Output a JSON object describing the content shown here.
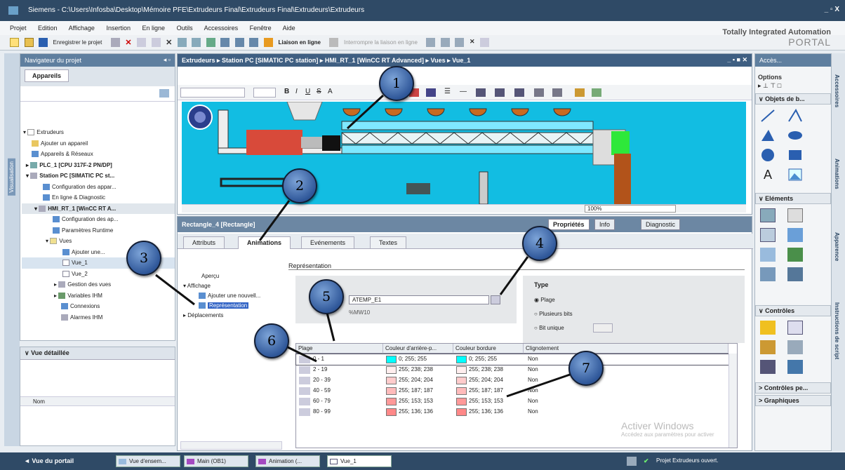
{
  "window": {
    "title": "Siemens  -  C:\\Users\\Infosba\\Desktop\\Mémoire PFE\\Extrudeurs Final\\Extrudeurs Final\\Extrudeurs\\Extrudeurs",
    "controls": "_ ▫ X"
  },
  "menu": [
    "Projet",
    "Edition",
    "Affichage",
    "Insertion",
    "En ligne",
    "Outils",
    "Accessoires",
    "Fenêtre",
    "Aide"
  ],
  "toolbar": {
    "save": "Enregistrer le projet",
    "online": "Liaison en ligne",
    "offline": "Interrompre la liaison en ligne"
  },
  "brand": {
    "line1": "Totally Integrated Automation",
    "line2": "PORTAL"
  },
  "sidebar_tab": "Visualisation",
  "project_nav": {
    "header": "Navigateur du projet",
    "tab": "Appareils",
    "items": [
      "Extrudeurs",
      "Ajouter un appareil",
      "Appareils & Réseaux",
      "PLC_1 [CPU 317F-2 PN/DP]",
      "Station PC [SIMATIC PC st...",
      "Configuration des appar...",
      "En ligne & Diagnostic",
      "HMI_RT_1 [WinCC RT A...",
      "Configuration des ap...",
      "Paramètres Runtime",
      "Vues",
      "Ajouter une...",
      "Vue_1",
      "Vue_2",
      "Gestion des vues",
      "Variables IHM",
      "Connexions",
      "Alarmes IHM"
    ]
  },
  "detail_view": {
    "header": "Vue détaillée",
    "col": "Nom"
  },
  "editor": {
    "breadcrumb": "Extrudeurs  ▸  Station PC [SIMATIC PC station]  ▸  HMI_RT_1 [WinCC RT Advanced]  ▸  Vues  ▸  Vue_1",
    "zoom": "100%"
  },
  "properties": {
    "title": "Rectangle_4 [Rectangle]",
    "tabs_right": [
      "Propriétés",
      "Info",
      "Diagnostic"
    ],
    "tabs": [
      "Attributs",
      "Animations",
      "Evénements",
      "Textes"
    ],
    "tree": [
      "Aperçu",
      "Affichage",
      "Ajouter une nouvell...",
      "Représentation",
      "Déplacements"
    ],
    "section": "Représentation",
    "tag": "ATEMP_E1",
    "address": "%MW10",
    "type_label": "Type",
    "types": [
      "Plage",
      "Plusieurs bits",
      "Bit unique"
    ],
    "columns": [
      "Plage",
      "Couleur d'arrière-p...",
      "Couleur bordure",
      "Clignotement"
    ],
    "rows": [
      {
        "range": "0 - 1",
        "bg": "0; 255; 255",
        "border": "0; 255; 255",
        "blink": "Non",
        "color": "#00ffff"
      },
      {
        "range": "2 - 19",
        "bg": "255; 238; 238",
        "border": "255; 238; 238",
        "blink": "Non",
        "color": "#ffeeee"
      },
      {
        "range": "20 - 39",
        "bg": "255; 204; 204",
        "border": "255; 204; 204",
        "blink": "Non",
        "color": "#ffcccc"
      },
      {
        "range": "40 - 59",
        "bg": "255; 187; 187",
        "border": "255; 187; 187",
        "blink": "Non",
        "color": "#ffbbbb"
      },
      {
        "range": "60 - 79",
        "bg": "255; 153; 153",
        "border": "255; 153; 153",
        "blink": "Non",
        "color": "#ff9999"
      },
      {
        "range": "80 - 99",
        "bg": "255; 136; 136",
        "border": "255; 136; 136",
        "blink": "Non",
        "color": "#ff8888"
      }
    ]
  },
  "watermark": {
    "l1": "Activer Windows",
    "l2": "Accédez aux paramètres pour activer"
  },
  "tasks": {
    "header": "Accès...",
    "options": "Options",
    "sections": [
      "Objets de b...",
      "Eléments",
      "Contrôles",
      "Contrôles pe...",
      "Graphiques"
    ],
    "strip": [
      "Accessoires",
      "Animations",
      "Apparence",
      "Instructions de script"
    ]
  },
  "status": {
    "portal": "◄  Vue du portail",
    "tasks": [
      "Vue d'ensem...",
      "Main (OB1)",
      "Animation (...",
      "Vue_1"
    ],
    "right": "Projet Extrudeurs ouvert."
  },
  "callouts": [
    "1",
    "2",
    "3",
    "4",
    "5",
    "6",
    "7"
  ],
  "colors": {
    "canvas": "#12bde2",
    "title": "#2f4a66",
    "accent": "#3f5f82"
  }
}
